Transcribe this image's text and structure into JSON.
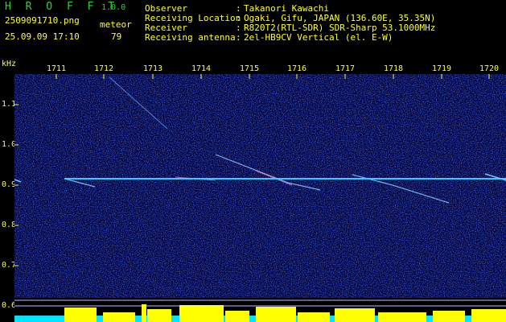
{
  "header": {
    "app_title": "H R O F F T",
    "version": "1.0.0",
    "filename": "2509091710.png",
    "mode_label": "meteor",
    "datetime": "25.09.09 17:10",
    "meteor_count": "79"
  },
  "info": [
    {
      "key": "Observer",
      "value": "Takanori Kawachi"
    },
    {
      "key": "Receiving Location",
      "value": "Ogaki, Gifu, JAPAN (136.60E, 35.35N)"
    },
    {
      "key": "Receiver",
      "value": "R820T2(RTL-SDR) SDR-Sharp 53.1000MHz"
    },
    {
      "key": "Receiving antenna",
      "value": "2el-HB9CV Vertical (el. E-W)"
    }
  ],
  "info_sep": ":",
  "spectrogram": {
    "unit_label": "kHz",
    "time_ticks": [
      "1711",
      "1712",
      "1713",
      "1714",
      "1715",
      "1716",
      "1717",
      "1718",
      "1719",
      "1720"
    ],
    "freq_ticks": [
      "1.1",
      "1.0",
      "0.9",
      "0.8",
      "0.7",
      "0.6",
      "0.5"
    ],
    "bottom_tick": "0.6",
    "colors": {
      "background": "#000033",
      "noise": "#1d2ab8",
      "carrier": "#33ccff",
      "activity": "#ffff00",
      "text": "#ffff33",
      "title": "#2bd52b"
    }
  }
}
